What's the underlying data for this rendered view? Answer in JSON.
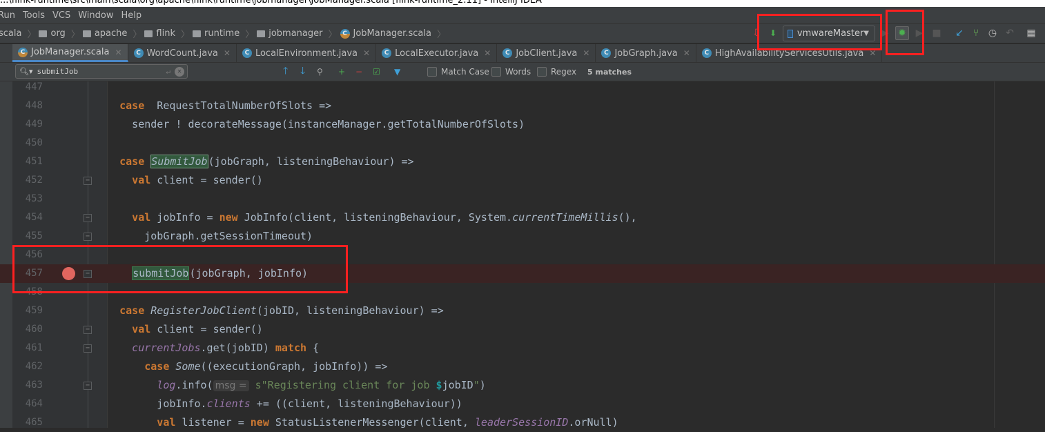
{
  "window": {
    "title": "...\\flink-runtime\\src\\main\\scala\\org\\apache\\flink\\runtime\\jobmanager\\JobManager.scala [flink-runtime_2.11] - IntelliJ IDEA"
  },
  "menu": [
    "Run",
    "Tools",
    "VCS",
    "Window",
    "Help"
  ],
  "breadcrumb": [
    "scala",
    "org",
    "apache",
    "flink",
    "runtime",
    "jobmanager",
    "JobManager.scala"
  ],
  "run_config": {
    "selected": "vmwareMaster"
  },
  "tabs": [
    {
      "label": "JobManager.scala",
      "active": true,
      "icon": "scala-class-icon"
    },
    {
      "label": "WordCount.java",
      "icon": "java-class-runnable-icon"
    },
    {
      "label": "LocalEnvironment.java",
      "icon": "java-class-icon"
    },
    {
      "label": "LocalExecutor.java",
      "icon": "java-class-icon"
    },
    {
      "label": "JobClient.java",
      "icon": "java-class-icon"
    },
    {
      "label": "JobGraph.java",
      "icon": "java-class-icon"
    },
    {
      "label": "HighAvailabilityServicesUtils.java",
      "icon": "java-class-icon"
    }
  ],
  "search": {
    "value": "submitJob",
    "match_case": "Match Case",
    "words": "Words",
    "regex": "Regex",
    "matches": "5 matches"
  },
  "colors": {
    "annotation": "#ff2020",
    "breakpoint": "#e0665f",
    "keyword": "#cc7832",
    "match": "#32593d"
  },
  "code": [
    {
      "n": "447",
      "t": []
    },
    {
      "n": "448",
      "t": [
        [
          "k",
          "    case"
        ],
        [
          "",
          "  RequestTotalNumberOfSlots =>"
        ]
      ]
    },
    {
      "n": "449",
      "t": [
        [
          "",
          "      sender ! decorateMessage(instanceManager.getTotalNumberOfSlots)"
        ]
      ]
    },
    {
      "n": "450",
      "t": []
    },
    {
      "n": "451",
      "t": [
        [
          "k",
          "    case "
        ],
        [
          "mi",
          "SubmitJob"
        ],
        [
          "",
          "(jobGraph, listeningBehaviour) =>"
        ]
      ]
    },
    {
      "n": "452",
      "fold": true,
      "t": [
        [
          "k",
          "      val"
        ],
        [
          "",
          " client = sender()"
        ]
      ]
    },
    {
      "n": "453",
      "t": []
    },
    {
      "n": "454",
      "fold": true,
      "t": [
        [
          "k",
          "      val"
        ],
        [
          "",
          " jobInfo = "
        ],
        [
          "k",
          "new"
        ],
        [
          "",
          " JobInfo(client, listeningBehaviour, System."
        ],
        [
          "ic",
          "currentTimeMillis"
        ],
        [
          "",
          "(),"
        ]
      ]
    },
    {
      "n": "455",
      "fold": true,
      "t": [
        [
          "",
          "        jobGraph.getSessionTimeout)"
        ]
      ]
    },
    {
      "n": "456",
      "t": []
    },
    {
      "n": "457",
      "breakpoint": true,
      "fold": true,
      "t": [
        [
          "",
          "      "
        ],
        [
          "m",
          "submitJob"
        ],
        [
          "",
          "(jobGraph, jobInfo)"
        ]
      ]
    },
    {
      "n": "458",
      "t": []
    },
    {
      "n": "459",
      "t": [
        [
          "k",
          "    case "
        ],
        [
          "ic",
          "RegisterJobClient"
        ],
        [
          "",
          "(jobID, listeningBehaviour) =>"
        ]
      ]
    },
    {
      "n": "460",
      "fold": true,
      "t": [
        [
          "k",
          "      val"
        ],
        [
          "",
          " client = sender()"
        ]
      ]
    },
    {
      "n": "461",
      "fold": true,
      "t": [
        [
          "i",
          "      currentJobs"
        ],
        [
          "",
          ".get(jobID) "
        ],
        [
          "k",
          "match"
        ],
        [
          "",
          " {"
        ]
      ]
    },
    {
      "n": "462",
      "t": [
        [
          "k",
          "        case "
        ],
        [
          "ic",
          "Some"
        ],
        [
          "",
          "((executionGraph, jobInfo)) =>"
        ]
      ]
    },
    {
      "n": "463",
      "fold": true,
      "t": [
        [
          "i",
          "          log"
        ],
        [
          "",
          ".info("
        ],
        [
          "h",
          "msg ="
        ],
        [
          "s",
          " s\"Registering client for job "
        ],
        [
          "d",
          "$"
        ],
        [
          "",
          "jobID"
        ],
        [
          "s",
          "\""
        ],
        [
          "",
          ")"
        ]
      ]
    },
    {
      "n": "464",
      "t": [
        [
          "",
          "          jobInfo."
        ],
        [
          "i",
          "clients"
        ],
        [
          "",
          " += ((client, listeningBehaviour))"
        ]
      ]
    },
    {
      "n": "465",
      "t": [
        [
          "k",
          "          val"
        ],
        [
          "",
          " listener = "
        ],
        [
          "k",
          "new"
        ],
        [
          "",
          " StatusListenerMessenger(client, "
        ],
        [
          "i",
          "leaderSessionID"
        ],
        [
          "",
          ".orNull)"
        ]
      ]
    }
  ]
}
